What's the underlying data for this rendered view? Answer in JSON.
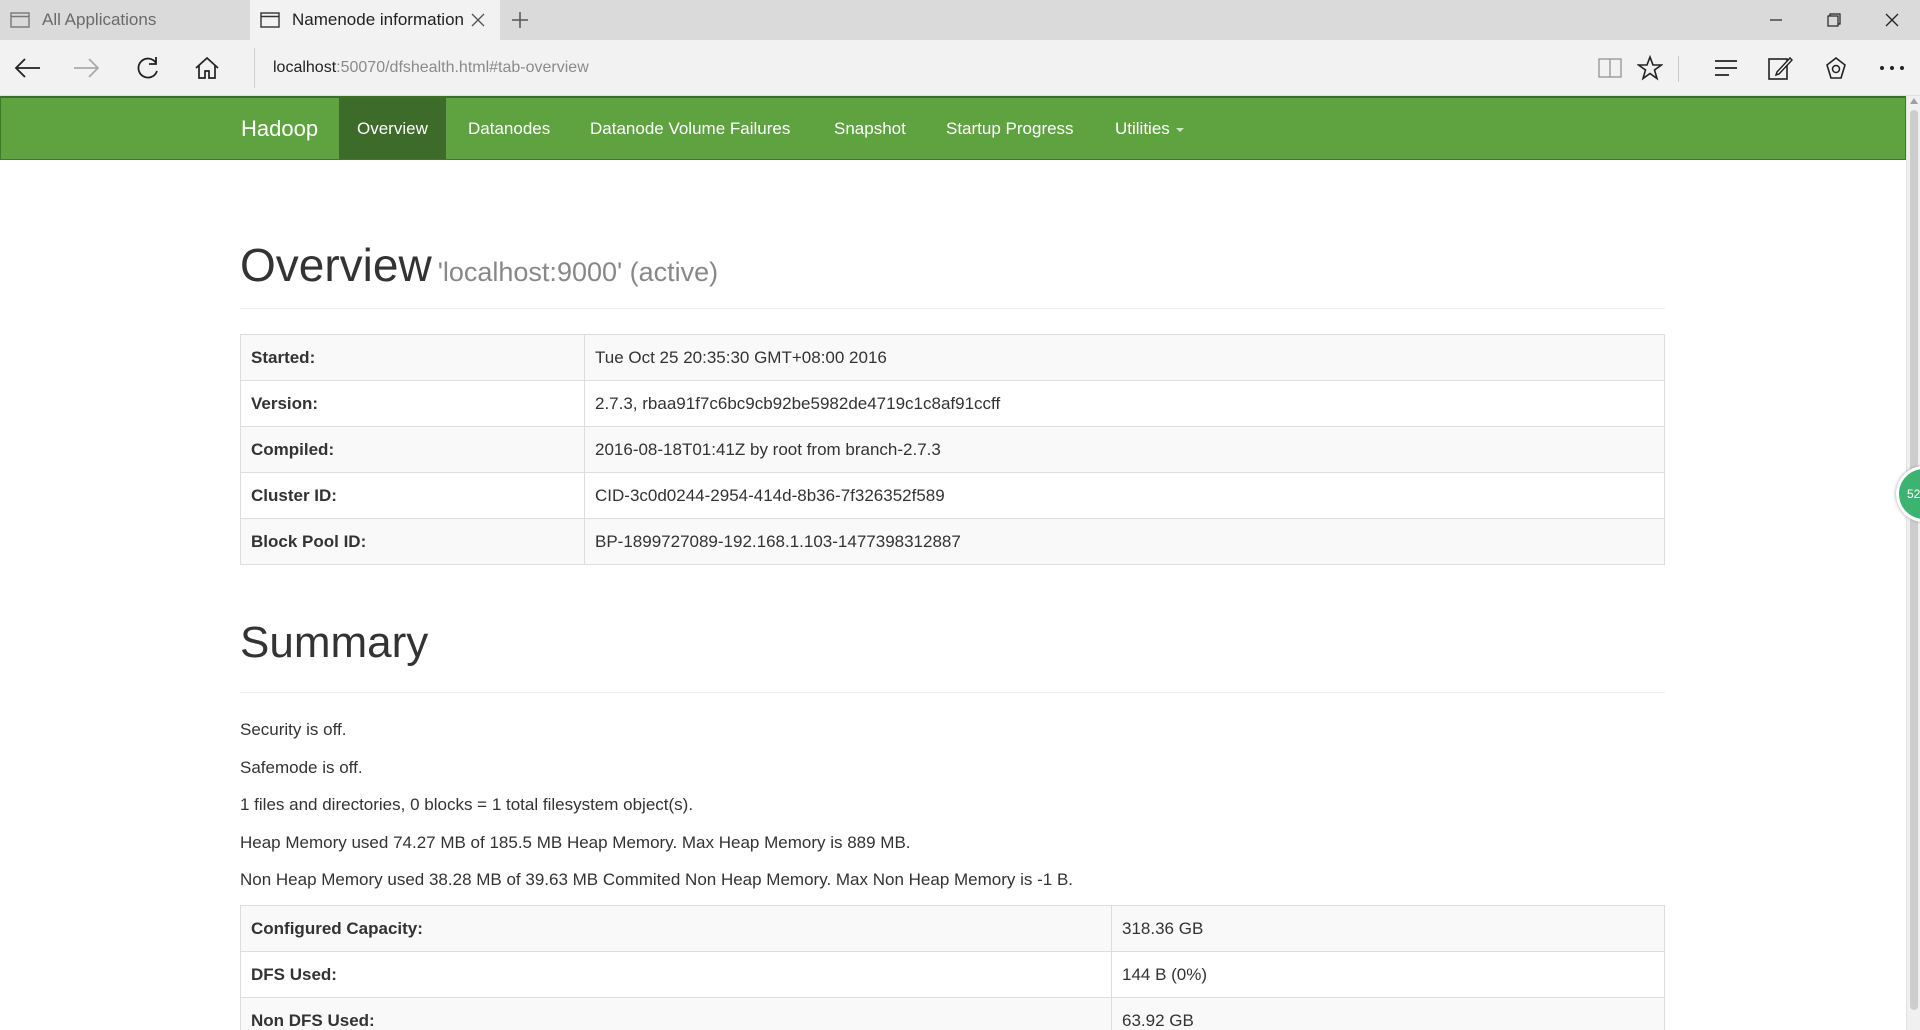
{
  "browser": {
    "tabs": [
      {
        "label": "All Applications",
        "active": false
      },
      {
        "label": "Namenode information",
        "active": true
      }
    ],
    "url_host": "localhost",
    "url_rest": ":50070/dfshealth.html#tab-overview"
  },
  "navbar": {
    "brand": "Hadoop",
    "items": [
      {
        "label": "Overview",
        "active": true
      },
      {
        "label": "Datanodes",
        "active": false
      },
      {
        "label": "Datanode Volume Failures",
        "active": false
      },
      {
        "label": "Snapshot",
        "active": false
      },
      {
        "label": "Startup Progress",
        "active": false
      },
      {
        "label": "Utilities",
        "active": false
      }
    ]
  },
  "overview": {
    "title": "Overview",
    "subtitle": "'localhost:9000' (active)",
    "rows": [
      {
        "key": "Started:",
        "value": "Tue Oct 25 20:35:30 GMT+08:00 2016"
      },
      {
        "key": "Version:",
        "value": "2.7.3, rbaa91f7c6bc9cb92be5982de4719c1c8af91ccff"
      },
      {
        "key": "Compiled:",
        "value": "2016-08-18T01:41Z by root from branch-2.7.3"
      },
      {
        "key": "Cluster ID:",
        "value": "CID-3c0d0244-2954-414d-8b36-7f326352f589"
      },
      {
        "key": "Block Pool ID:",
        "value": "BP-1899727089-192.168.1.103-1477398312887"
      }
    ]
  },
  "summary": {
    "title": "Summary",
    "lines": [
      "Security is off.",
      "Safemode is off.",
      "1 files and directories, 0 blocks = 1 total filesystem object(s).",
      "Heap Memory used 74.27 MB of 185.5 MB Heap Memory. Max Heap Memory is 889 MB.",
      "Non Heap Memory used 38.28 MB of 39.63 MB Commited Non Heap Memory. Max Non Heap Memory is -1 B."
    ],
    "rows": [
      {
        "key": "Configured Capacity:",
        "value": "318.36 GB"
      },
      {
        "key": "DFS Used:",
        "value": "144 B (0%)"
      },
      {
        "key": "Non DFS Used:",
        "value": "63.92 GB"
      }
    ]
  },
  "side_badge": "52",
  "colors": {
    "navbar": "#5fa341",
    "navbar_active": "#3d6b2a"
  }
}
